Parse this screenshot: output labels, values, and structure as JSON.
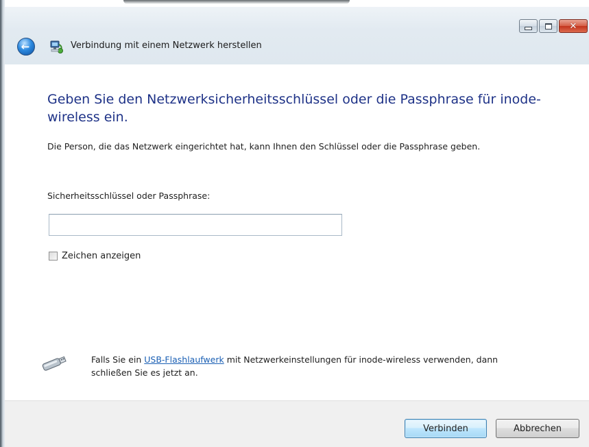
{
  "window": {
    "title": "Verbindung mit einem Netzwerk herstellen",
    "caption_buttons": {
      "minimize_icon": "minimize-icon",
      "maximize_icon": "maximize-icon",
      "close_icon": "close-icon",
      "close_glyph": "✕"
    },
    "back_glyph": "←"
  },
  "content": {
    "heading": "Geben Sie den Netzwerksicherheitsschlüssel oder die Passphrase für inode-wireless ein.",
    "description": "Die Person, die das Netzwerk eingerichtet hat, kann Ihnen den Schlüssel oder die Passphrase geben.",
    "field_label": "Sicherheitsschlüssel oder Passphrase:",
    "field_value": "",
    "show_chars_label": "Zeichen anzeigen",
    "show_chars_checked": false,
    "usb_hint": {
      "prefix": "Falls Sie ein ",
      "link": "USB-Flashlaufwerk",
      "suffix": " mit Netzwerkeinstellungen für inode-wireless verwenden, dann schließen Sie es jetzt an."
    }
  },
  "footer": {
    "connect_label": "Verbinden",
    "cancel_label": "Abbrechen"
  },
  "colors": {
    "heading": "#1e3287",
    "link": "#1a5fb4",
    "footer_bg": "#f0f0f0"
  }
}
